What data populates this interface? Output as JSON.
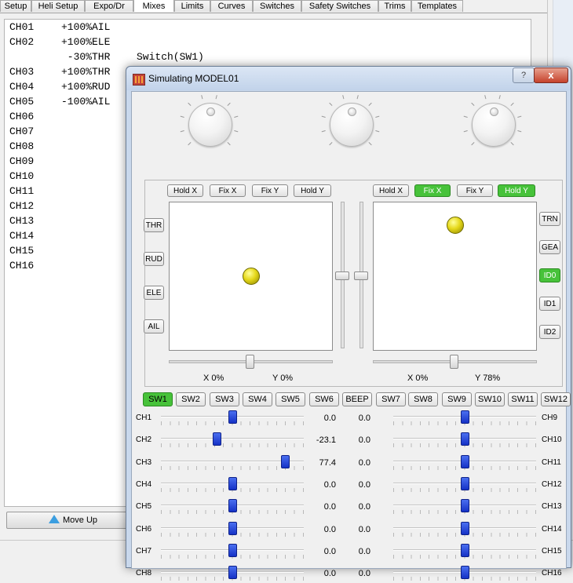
{
  "tabs": [
    {
      "label": "Setup",
      "active": false
    },
    {
      "label": "Heli Setup",
      "active": false
    },
    {
      "label": "Expo/Dr",
      "active": false
    },
    {
      "label": "Mixes",
      "active": true
    },
    {
      "label": "Limits",
      "active": false
    },
    {
      "label": "Curves",
      "active": false
    },
    {
      "label": "Switches",
      "active": false
    },
    {
      "label": "Safety Switches",
      "active": false
    },
    {
      "label": "Trims",
      "active": false
    },
    {
      "label": "Templates",
      "active": false
    }
  ],
  "mix_lines": [
    {
      "ch": "CH01",
      "mix": "+100%AIL",
      "sw": ""
    },
    {
      "ch": "CH02",
      "mix": "+100%ELE",
      "sw": ""
    },
    {
      "ch": "",
      "mix": " -30%THR",
      "sw": "Switch(SW1)"
    },
    {
      "ch": "CH03",
      "mix": "+100%THR",
      "sw": ""
    },
    {
      "ch": "CH04",
      "mix": "+100%RUD",
      "sw": ""
    },
    {
      "ch": "CH05",
      "mix": "-100%AIL",
      "sw": ""
    },
    {
      "ch": "CH06",
      "mix": "",
      "sw": ""
    },
    {
      "ch": "CH07",
      "mix": "",
      "sw": ""
    },
    {
      "ch": "CH08",
      "mix": "",
      "sw": ""
    },
    {
      "ch": "CH09",
      "mix": "",
      "sw": ""
    },
    {
      "ch": "CH10",
      "mix": "",
      "sw": ""
    },
    {
      "ch": "CH11",
      "mix": "",
      "sw": ""
    },
    {
      "ch": "CH12",
      "mix": "",
      "sw": ""
    },
    {
      "ch": "CH13",
      "mix": "",
      "sw": ""
    },
    {
      "ch": "CH14",
      "mix": "",
      "sw": ""
    },
    {
      "ch": "CH15",
      "mix": "",
      "sw": ""
    },
    {
      "ch": "CH16",
      "mix": "",
      "sw": ""
    }
  ],
  "move_up_label": "Move Up",
  "sim": {
    "title": "Simulating MODEL01",
    "help_glyph": "?",
    "close_glyph": "x",
    "left_top_buttons": [
      {
        "label": "Hold X",
        "on": false
      },
      {
        "label": "Fix X",
        "on": false
      },
      {
        "label": "Fix Y",
        "on": false
      },
      {
        "label": "Hold Y",
        "on": false
      }
    ],
    "right_top_buttons": [
      {
        "label": "Hold X",
        "on": false
      },
      {
        "label": "Fix X",
        "on": true
      },
      {
        "label": "Fix Y",
        "on": false
      },
      {
        "label": "Hold Y",
        "on": true
      }
    ],
    "left_side_buttons": [
      "THR",
      "RUD",
      "ELE",
      "AIL"
    ],
    "right_side_buttons": [
      {
        "label": "TRN",
        "on": false
      },
      {
        "label": "GEA",
        "on": false
      },
      {
        "label": "ID0",
        "on": true
      },
      {
        "label": "ID1",
        "on": false
      },
      {
        "label": "ID2",
        "on": false
      }
    ],
    "left_stick": {
      "x_label": "X 0%",
      "y_label": "Y 0%",
      "x": 0.0,
      "y": 0.0
    },
    "right_stick": {
      "x_label": "X 0%",
      "y_label": "Y 78%",
      "x": 0.0,
      "y": 0.78
    },
    "switches": [
      {
        "label": "SW1",
        "on": true
      },
      {
        "label": "SW2",
        "on": false
      },
      {
        "label": "SW3",
        "on": false
      },
      {
        "label": "SW4",
        "on": false
      },
      {
        "label": "SW5",
        "on": false
      },
      {
        "label": "SW6",
        "on": false
      },
      {
        "label": "BEEP",
        "on": false
      },
      {
        "label": "SW7",
        "on": false
      },
      {
        "label": "SW8",
        "on": false
      },
      {
        "label": "SW9",
        "on": false
      },
      {
        "label": "SW10",
        "on": false
      },
      {
        "label": "SW11",
        "on": false
      },
      {
        "label": "SW12",
        "on": false
      }
    ],
    "channels_left": [
      {
        "label": "CH1",
        "value": "0.0",
        "pct": 0.0
      },
      {
        "label": "CH2",
        "value": "-23.1",
        "pct": -23.1
      },
      {
        "label": "CH3",
        "value": "77.4",
        "pct": 77.4
      },
      {
        "label": "CH4",
        "value": "0.0",
        "pct": 0.0
      },
      {
        "label": "CH5",
        "value": "0.0",
        "pct": 0.0
      },
      {
        "label": "CH6",
        "value": "0.0",
        "pct": 0.0
      },
      {
        "label": "CH7",
        "value": "0.0",
        "pct": 0.0
      },
      {
        "label": "CH8",
        "value": "0.0",
        "pct": 0.0
      }
    ],
    "channels_right": [
      {
        "label": "CH9",
        "value": "0.0",
        "pct": 0.0
      },
      {
        "label": "CH10",
        "value": "0.0",
        "pct": 0.0
      },
      {
        "label": "CH11",
        "value": "0.0",
        "pct": 0.0
      },
      {
        "label": "CH12",
        "value": "0.0",
        "pct": 0.0
      },
      {
        "label": "CH13",
        "value": "0.0",
        "pct": 0.0
      },
      {
        "label": "CH14",
        "value": "0.0",
        "pct": 0.0
      },
      {
        "label": "CH15",
        "value": "0.0",
        "pct": 0.0
      },
      {
        "label": "CH16",
        "value": "0.0",
        "pct": 0.0
      }
    ],
    "colors": {
      "active_green": "#47c23a",
      "slider_blue": "#1f3fd8",
      "ball_yellow": "#e5d81a"
    }
  }
}
